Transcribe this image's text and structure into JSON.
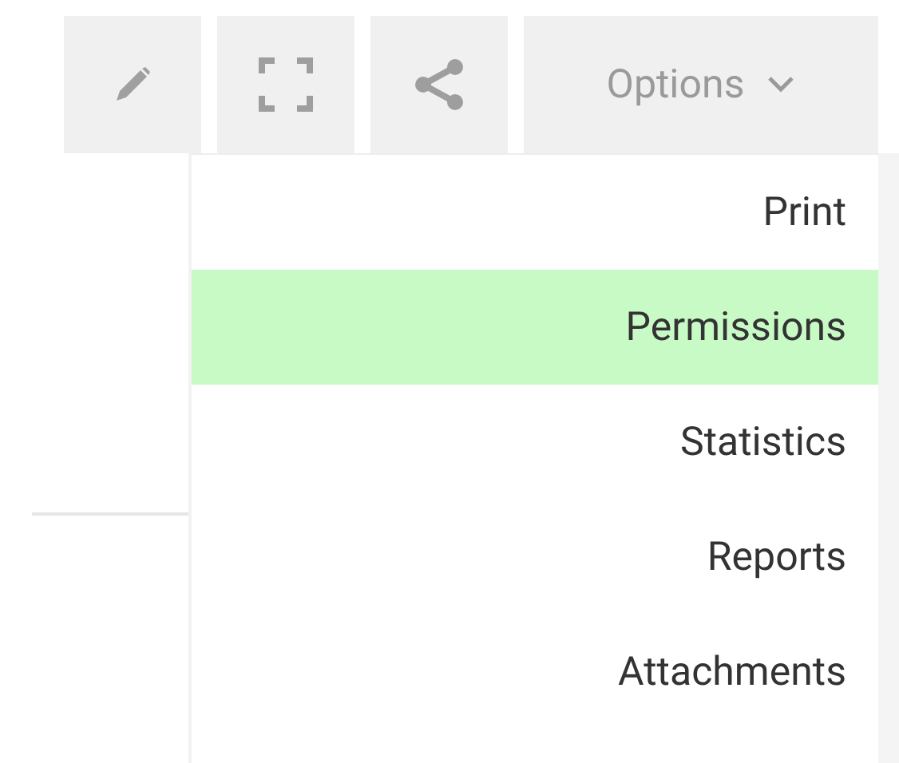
{
  "toolbar": {
    "buttons": [
      {
        "kind": "edit"
      },
      {
        "kind": "fullscreen"
      },
      {
        "kind": "share"
      }
    ],
    "options_button": {
      "label": "Options"
    }
  },
  "menu": {
    "items": [
      {
        "label": "Print",
        "selected": false
      },
      {
        "label": "Permissions",
        "selected": true
      },
      {
        "label": "Statistics",
        "selected": false
      },
      {
        "label": "Reports",
        "selected": false
      },
      {
        "label": "Attachments",
        "selected": false
      }
    ]
  }
}
